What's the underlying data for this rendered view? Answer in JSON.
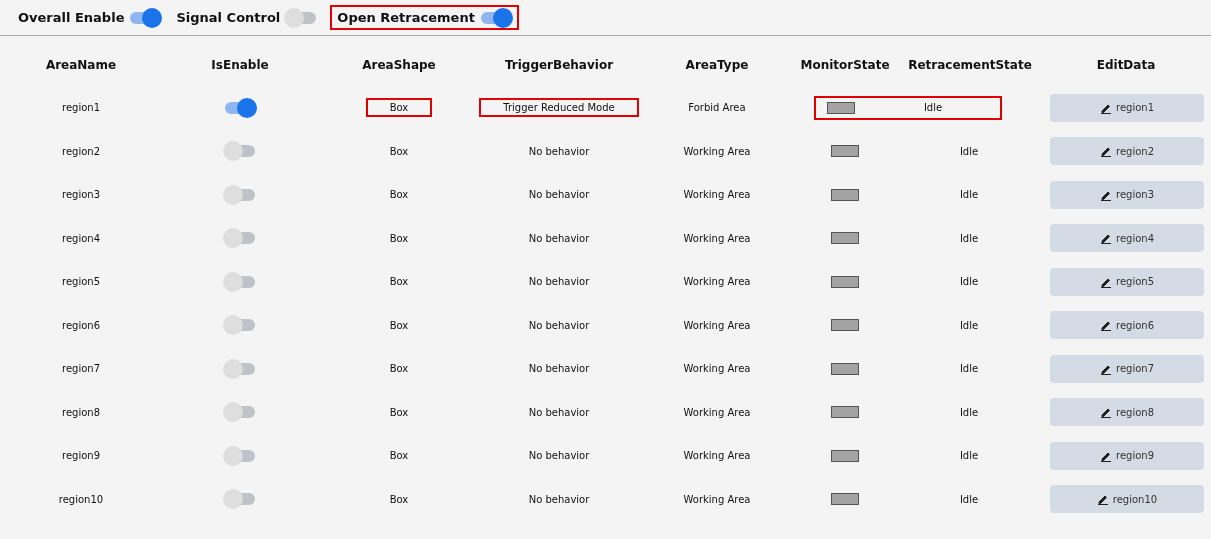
{
  "toolbar": [
    {
      "label": "Overall Enable",
      "on": true,
      "highlighted": false
    },
    {
      "label": "Signal Control",
      "on": false,
      "highlighted": false
    },
    {
      "label": "Open Retracement",
      "on": true,
      "highlighted": true
    }
  ],
  "table": {
    "columns": [
      "AreaName",
      "IsEnable",
      "AreaShape",
      "TriggerBehavior",
      "AreaType",
      "MonitorState",
      "RetracementState",
      "EditData"
    ],
    "rows": [
      {
        "name": "region1",
        "enabled": true,
        "shape": "Box",
        "trigger": "Trigger Reduced Mode",
        "type": "Forbid Area",
        "state": "Idle",
        "edit": "region1",
        "highlight_shape": true,
        "highlight_trigger": true,
        "highlight_state": true
      },
      {
        "name": "region2",
        "enabled": false,
        "shape": "Box",
        "trigger": "No behavior",
        "type": "Working Area",
        "state": "Idle",
        "edit": "region2",
        "highlight_shape": false,
        "highlight_trigger": false,
        "highlight_state": false
      },
      {
        "name": "region3",
        "enabled": false,
        "shape": "Box",
        "trigger": "No behavior",
        "type": "Working Area",
        "state": "Idle",
        "edit": "region3",
        "highlight_shape": false,
        "highlight_trigger": false,
        "highlight_state": false
      },
      {
        "name": "region4",
        "enabled": false,
        "shape": "Box",
        "trigger": "No behavior",
        "type": "Working Area",
        "state": "Idle",
        "edit": "region4",
        "highlight_shape": false,
        "highlight_trigger": false,
        "highlight_state": false
      },
      {
        "name": "region5",
        "enabled": false,
        "shape": "Box",
        "trigger": "No behavior",
        "type": "Working Area",
        "state": "Idle",
        "edit": "region5",
        "highlight_shape": false,
        "highlight_trigger": false,
        "highlight_state": false
      },
      {
        "name": "region6",
        "enabled": false,
        "shape": "Box",
        "trigger": "No behavior",
        "type": "Working Area",
        "state": "Idle",
        "edit": "region6",
        "highlight_shape": false,
        "highlight_trigger": false,
        "highlight_state": false
      },
      {
        "name": "region7",
        "enabled": false,
        "shape": "Box",
        "trigger": "No behavior",
        "type": "Working Area",
        "state": "Idle",
        "edit": "region7",
        "highlight_shape": false,
        "highlight_trigger": false,
        "highlight_state": false
      },
      {
        "name": "region8",
        "enabled": false,
        "shape": "Box",
        "trigger": "No behavior",
        "type": "Working Area",
        "state": "Idle",
        "edit": "region8",
        "highlight_shape": false,
        "highlight_trigger": false,
        "highlight_state": false
      },
      {
        "name": "region9",
        "enabled": false,
        "shape": "Box",
        "trigger": "No behavior",
        "type": "Working Area",
        "state": "Idle",
        "edit": "region9",
        "highlight_shape": false,
        "highlight_trigger": false,
        "highlight_state": false
      },
      {
        "name": "region10",
        "enabled": false,
        "shape": "Box",
        "trigger": "No behavior",
        "type": "Working Area",
        "state": "Idle",
        "edit": "region10",
        "highlight_shape": false,
        "highlight_trigger": false,
        "highlight_state": false
      }
    ]
  }
}
